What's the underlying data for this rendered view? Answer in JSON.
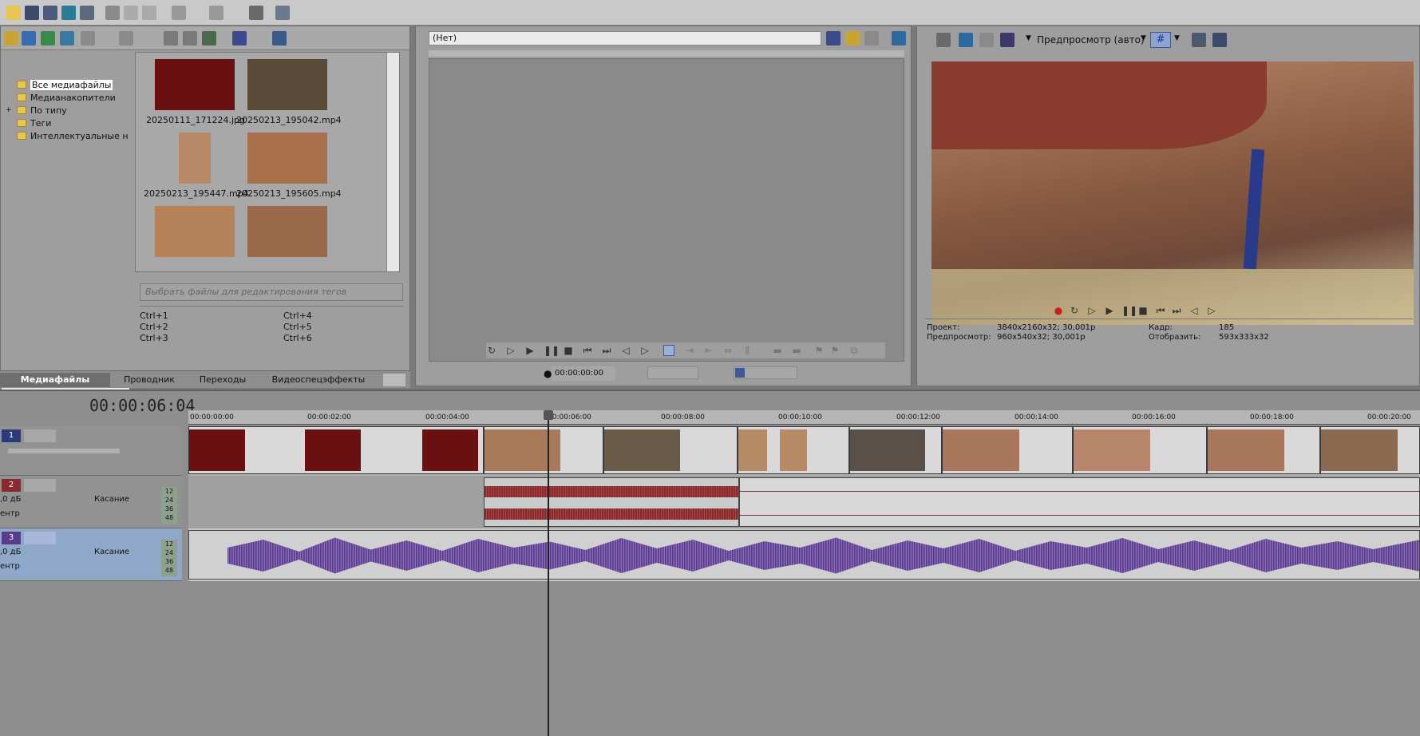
{
  "toolbar": {
    "icons": [
      "open-icon",
      "save-icon",
      "save-as-icon",
      "render-icon",
      "properties-icon",
      "cut-icon",
      "copy-icon",
      "paste-icon",
      "undo-icon",
      "redo-icon",
      "brush-icon",
      "help-icon"
    ]
  },
  "explorer": {
    "tree": [
      {
        "label": "Все медиафайлы",
        "selected": true
      },
      {
        "label": "Медианакопители"
      },
      {
        "label": "По типу",
        "expand": "+"
      },
      {
        "label": "Теги"
      },
      {
        "label": "Интеллектуальные накопители"
      }
    ],
    "files": [
      {
        "name": "20250111_171224.jpg",
        "color": "#6b1010"
      },
      {
        "name": "20250213_195042.mp4",
        "color": "#5a4a38"
      },
      {
        "name": "20250213_195447.mp4",
        "color": "#b98a68"
      },
      {
        "name": "20250213_195605.mp4",
        "color": "#a8704a"
      },
      {
        "name": "",
        "color": "#b5825a"
      },
      {
        "name": "",
        "color": "#9a6a48"
      }
    ],
    "tag_placeholder": "Выбрать файлы для редактирования тегов",
    "shortcuts": [
      "Ctrl+1",
      "Ctrl+4",
      "Ctrl+2",
      "Ctrl+5",
      "Ctrl+3",
      "Ctrl+6"
    ],
    "tabs": [
      "Медиафайлы проекта",
      "Проводник",
      "Переходы",
      "Видеоспецэффекты"
    ]
  },
  "trimmer": {
    "dropdown": "(Нет)",
    "timecode": "00:00:00:00"
  },
  "preview": {
    "mode": "Предпросмотр (авто)",
    "project_label": "Проект:",
    "project_value": "3840x2160x32; 30,001p",
    "preview_label": "Предпросмотр:",
    "preview_value": "960x540x32; 30,001p",
    "frame_label": "Кадр:",
    "frame_value": "185",
    "display_label": "Отобразить:",
    "display_value": "593x333x32"
  },
  "timeline": {
    "timecode": "00:00:06:04",
    "ruler": [
      "00:00:00:00",
      "00:00:02:00",
      "00:00:04:00",
      "00:00:06:00",
      "00:00:08:00",
      "00:00:10:00",
      "00:00:12:00",
      "00:00:14:00",
      "00:00:16:00",
      "00:00:18:00",
      "00:00:20:00"
    ],
    "tracks": [
      {
        "num": "1",
        "type": "video"
      },
      {
        "num": "2",
        "type": "audio",
        "vol": ",0 дБ",
        "pan": "ентр",
        "mode": "Касание",
        "meter": [
          "12",
          "24",
          "36",
          "48"
        ]
      },
      {
        "num": "3",
        "type": "audio",
        "vol": ",0 дБ",
        "pan": "ентр",
        "mode": "Касание",
        "meter": [
          "12",
          "24",
          "36",
          "48"
        ]
      }
    ]
  },
  "colors": {
    "waveform_red": "#8a2a2a",
    "waveform_purple": "#6b4c9a",
    "selected_track": "#8fa8c8"
  }
}
